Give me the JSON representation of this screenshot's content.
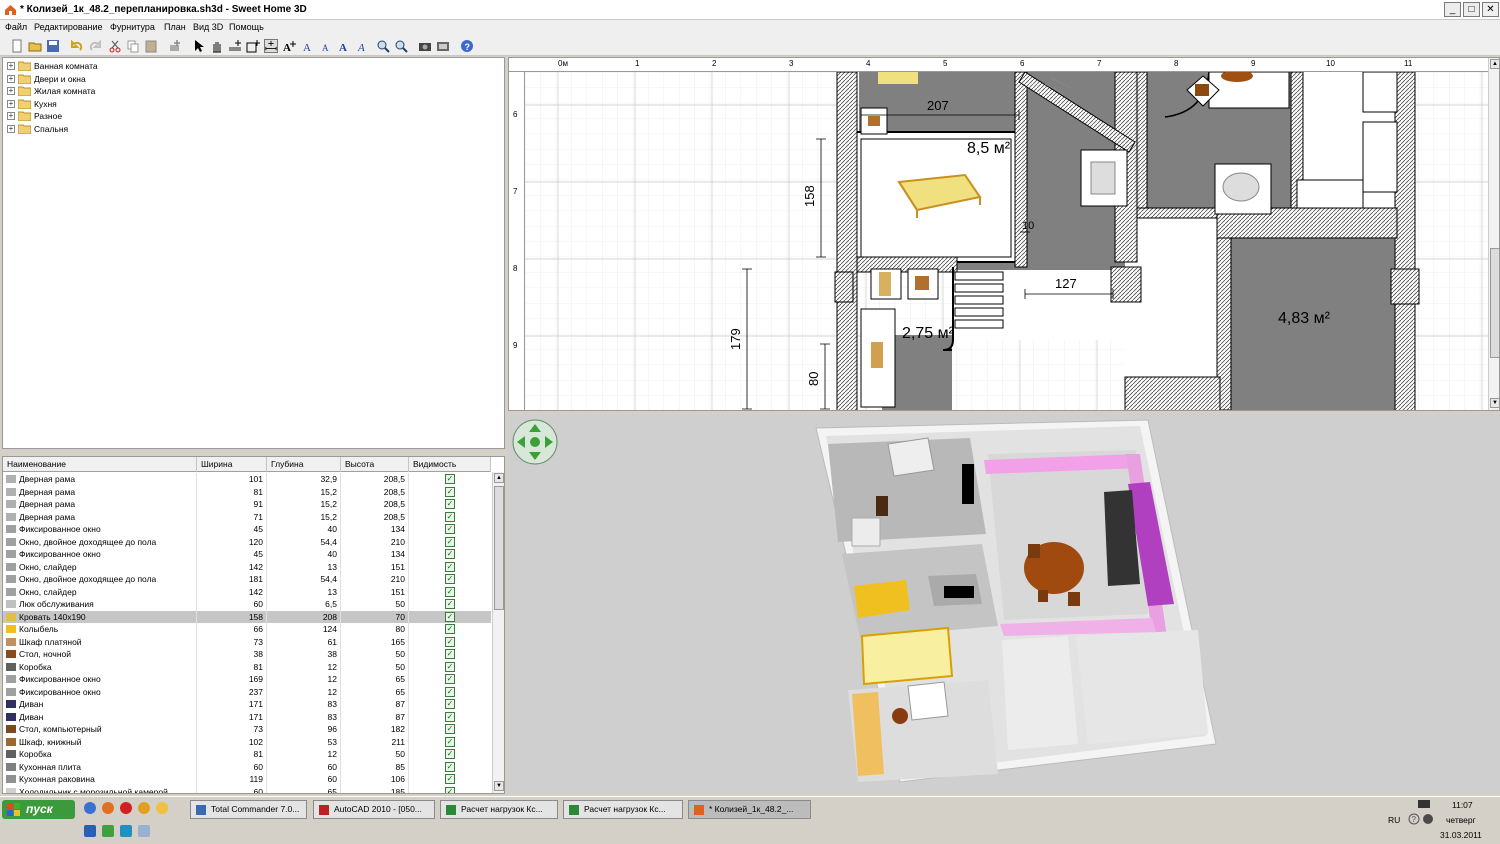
{
  "window": {
    "title": "* Колизей_1к_48.2_перепланировка.sh3d - Sweet Home 3D",
    "controls": {
      "minimize": "_",
      "maximize": "□",
      "close": "✕"
    }
  },
  "menu": [
    "Файл",
    "Редактирование",
    "Фурнитура",
    "План",
    "Вид 3D",
    "Помощь"
  ],
  "toolbar_icons": [
    "new-file-icon",
    "open-file-icon",
    "save-icon",
    "undo-icon",
    "redo-icon",
    "cut-icon",
    "copy-icon",
    "paste-icon",
    "add-furniture-icon",
    "select-arrow-icon",
    "pan-hand-icon",
    "create-walls-icon",
    "create-rooms-icon",
    "create-dimensions-icon",
    "add-text-icon",
    "increase-text-icon",
    "decrease-text-icon",
    "bold-text-icon",
    "italic-text-icon",
    "zoom-in-icon",
    "zoom-out-icon",
    "photo-icon",
    "video-icon",
    "help-icon"
  ],
  "catalog": {
    "categories": [
      "Ванная комната",
      "Двери и окна",
      "Жилая комната",
      "Кухня",
      "Разное",
      "Спальня"
    ]
  },
  "furniture_table": {
    "columns": [
      "Наименование",
      "Ширина",
      "Глубина",
      "Высота",
      "Видимость"
    ],
    "selected_index": 11,
    "rows": [
      {
        "icon": "door-icon",
        "name": "Дверная рама",
        "width": "101",
        "depth": "32,9",
        "height": "208,5",
        "visible": true
      },
      {
        "icon": "door-icon",
        "name": "Дверная рама",
        "width": "81",
        "depth": "15,2",
        "height": "208,5",
        "visible": true
      },
      {
        "icon": "door-icon",
        "name": "Дверная рама",
        "width": "91",
        "depth": "15,2",
        "height": "208,5",
        "visible": true
      },
      {
        "icon": "door-icon",
        "name": "Дверная рама",
        "width": "71",
        "depth": "15,2",
        "height": "208,5",
        "visible": true
      },
      {
        "icon": "window-icon",
        "name": "Фиксированное окно",
        "width": "45",
        "depth": "40",
        "height": "134",
        "visible": true
      },
      {
        "icon": "window-icon",
        "name": "Окно, двойное доходящее до пола",
        "width": "120",
        "depth": "54,4",
        "height": "210",
        "visible": true
      },
      {
        "icon": "window-icon",
        "name": "Фиксированное окно",
        "width": "45",
        "depth": "40",
        "height": "134",
        "visible": true
      },
      {
        "icon": "window-icon",
        "name": "Окно, слайдер",
        "width": "142",
        "depth": "13",
        "height": "151",
        "visible": true
      },
      {
        "icon": "window-icon",
        "name": "Окно, двойное доходящее до пола",
        "width": "181",
        "depth": "54,4",
        "height": "210",
        "visible": true
      },
      {
        "icon": "window-icon",
        "name": "Окно, слайдер",
        "width": "142",
        "depth": "13",
        "height": "151",
        "visible": true
      },
      {
        "icon": "hatch-icon",
        "name": "Люк обслуживания",
        "width": "60",
        "depth": "6,5",
        "height": "50",
        "visible": true
      },
      {
        "icon": "bed-icon",
        "name": "Кровать 140х190",
        "width": "158",
        "depth": "208",
        "height": "70",
        "visible": true
      },
      {
        "icon": "cradle-icon",
        "name": "Колыбель",
        "width": "66",
        "depth": "124",
        "height": "80",
        "visible": true
      },
      {
        "icon": "wardrobe-icon",
        "name": "Шкаф платяной",
        "width": "73",
        "depth": "61",
        "height": "165",
        "visible": true
      },
      {
        "icon": "nightstand-icon",
        "name": "Стол, ночной",
        "width": "38",
        "depth": "38",
        "height": "50",
        "visible": true
      },
      {
        "icon": "box-icon",
        "name": "Коробка",
        "width": "81",
        "depth": "12",
        "height": "50",
        "visible": true
      },
      {
        "icon": "window-icon",
        "name": "Фиксированное окно",
        "width": "169",
        "depth": "12",
        "height": "65",
        "visible": true
      },
      {
        "icon": "window-icon",
        "name": "Фиксированное окно",
        "width": "237",
        "depth": "12",
        "height": "65",
        "visible": true
      },
      {
        "icon": "sofa-icon",
        "name": "Диван",
        "width": "171",
        "depth": "83",
        "height": "87",
        "visible": true
      },
      {
        "icon": "sofa-icon",
        "name": "Диван",
        "width": "171",
        "depth": "83",
        "height": "87",
        "visible": true
      },
      {
        "icon": "desk-icon",
        "name": "Стол, компьютерный",
        "width": "73",
        "depth": "96",
        "height": "182",
        "visible": true
      },
      {
        "icon": "bookcase-icon",
        "name": "Шкаф, книжный",
        "width": "102",
        "depth": "53",
        "height": "211",
        "visible": true
      },
      {
        "icon": "box-icon",
        "name": "Коробка",
        "width": "81",
        "depth": "12",
        "height": "50",
        "visible": true
      },
      {
        "icon": "stove-icon",
        "name": "Кухонная плита",
        "width": "60",
        "depth": "60",
        "height": "85",
        "visible": true
      },
      {
        "icon": "sink-icon",
        "name": "Кухонная раковина",
        "width": "119",
        "depth": "60",
        "height": "106",
        "visible": true
      },
      {
        "icon": "fridge-icon",
        "name": "Холодильник с морозильной камерой",
        "width": "60",
        "depth": "65",
        "height": "185",
        "visible": true
      }
    ]
  },
  "plan": {
    "ruler_top": [
      "0м",
      "1",
      "2",
      "3",
      "4",
      "5",
      "6",
      "7",
      "8",
      "9",
      "10",
      "11"
    ],
    "ruler_left": [
      "6",
      "7",
      "8",
      "9"
    ],
    "room_areas": [
      "8,5 м²",
      "2,75 м²",
      "4,83 м²"
    ],
    "dimensions": [
      "207",
      "158",
      "10",
      "127",
      "179",
      "80"
    ]
  },
  "taskbar": {
    "start_label": "пуск",
    "tasks": [
      "Total Commander 7.0...",
      "AutoCAD 2010 - [050...",
      "Расчет нагрузок Кс...",
      "Расчет нагрузок Кс...",
      "* Колизей_1к_48.2_..."
    ],
    "active_task": 4,
    "tray": {
      "lang": "RU",
      "time": "11:07",
      "day": "четверг",
      "date": "31.03.2011"
    }
  },
  "colors": {
    "selected_row": "#c6c6c6",
    "wall_hatch": "#555555",
    "room_floor": "#808080",
    "pink_wall": "#e8a0e0",
    "sofa_purple": "#b040c0"
  }
}
